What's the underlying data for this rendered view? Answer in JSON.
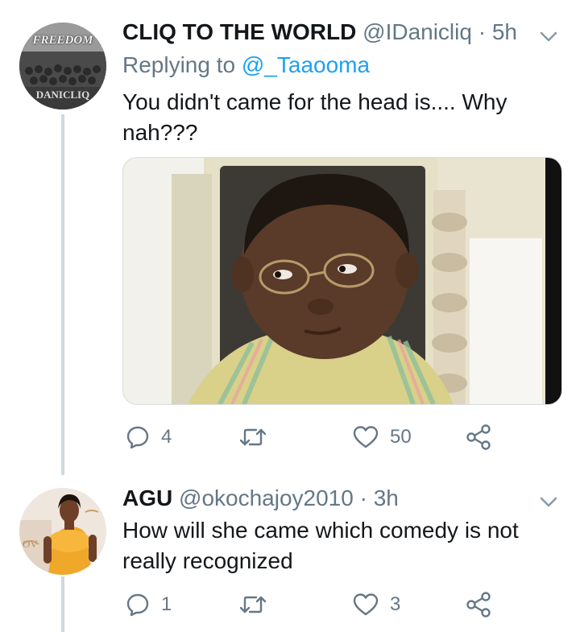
{
  "tweets": [
    {
      "name": "CLIQ TO THE WORLD",
      "handle": "@IDanicliq",
      "dot": "·",
      "time": "5h",
      "reply_prefix": "Replying to",
      "reply_mention": "@_Taaooma",
      "text": "You didn't came for the head is.... Why nah???",
      "avatar_text_top": "FREEDOM",
      "avatar_text_bottom": "DANICLIQ",
      "reply_icon": "reply-icon",
      "retweet_icon": "retweet-icon",
      "like_icon": "heart-icon",
      "share_icon": "share-icon",
      "reply_count": "4",
      "retweet_count": "",
      "like_count": "50"
    },
    {
      "name": "AGU",
      "handle": "@okochajoy2010",
      "dot": "·",
      "time": "3h",
      "text": "How will she came which comedy is not really recognized",
      "reply_icon": "reply-icon",
      "retweet_icon": "retweet-icon",
      "like_icon": "heart-icon",
      "share_icon": "share-icon",
      "reply_count": "1",
      "retweet_count": "",
      "like_count": "3"
    }
  ],
  "colors": {
    "text": "#14171a",
    "secondary": "#657786",
    "link": "#1da1f2",
    "thread_line": "#cfd9de"
  }
}
